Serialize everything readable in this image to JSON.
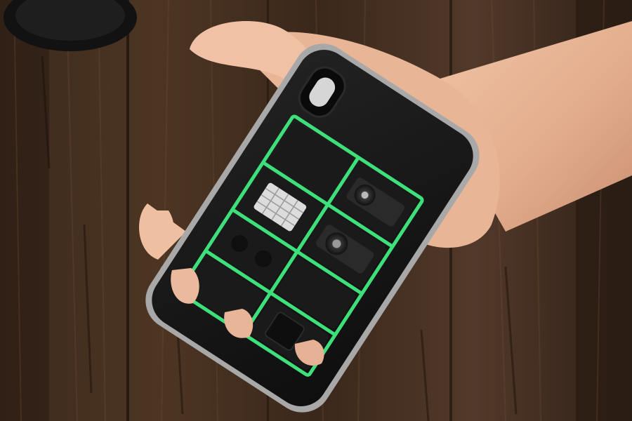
{
  "colors": {
    "wood_dark": "#24170f",
    "wood_mid": "#4a3322",
    "wood_light": "#6b4a30",
    "case_black": "#161616",
    "module_black": "#1c1c1c",
    "rail_green": "#3de07a",
    "skin": "#e8b89a",
    "skin_shadow": "#c98f70",
    "phone_edge": "#9a9a9a"
  },
  "icons": {
    "background": "wooden-table-surface",
    "case": "modular-phone-case",
    "hand": "hand",
    "accessory": "lens-cap",
    "speaker_a": "speaker-module-icon",
    "speaker_b": "speaker-module-icon",
    "light": "flashlight-module-icon"
  }
}
